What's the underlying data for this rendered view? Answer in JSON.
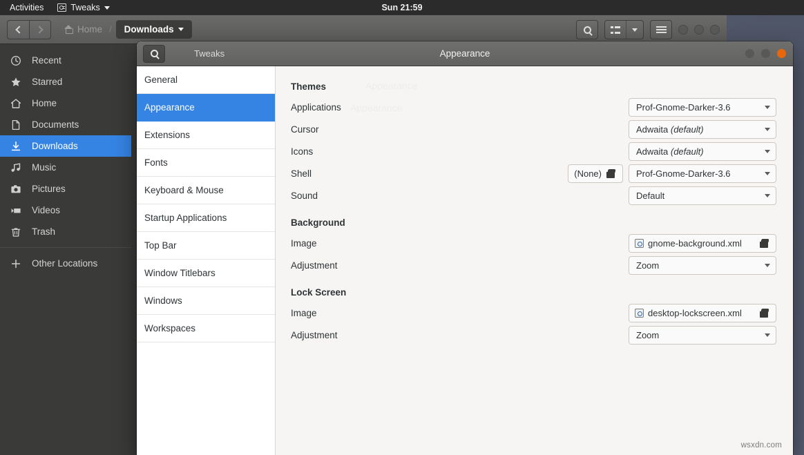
{
  "topbar": {
    "activities": "Activities",
    "app_name": "Tweaks",
    "app_icon": "tweaks-app-icon",
    "clock": "Sun 21:59"
  },
  "file_manager": {
    "nav": {
      "back_icon": "chevron-left-icon",
      "forward_icon": "chevron-right-icon"
    },
    "breadcrumb": {
      "home_icon": "home-icon",
      "home_label": "Home",
      "separator": "/",
      "current_label": "Downloads",
      "current_caret": "chevron-down-icon"
    },
    "header_buttons": {
      "search_icon": "search-icon",
      "view_list_icon": "view-list-icon",
      "view_caret_icon": "chevron-down-icon",
      "menu_icon": "hamburger-menu-icon",
      "minimize": "minimize-button",
      "maximize": "maximize-button",
      "close": "close-button"
    },
    "places": [
      {
        "label": "Recent",
        "icon": "clock-icon",
        "selected": false
      },
      {
        "label": "Starred",
        "icon": "star-icon",
        "selected": false
      },
      {
        "label": "Home",
        "icon": "home-icon",
        "selected": false
      },
      {
        "label": "Documents",
        "icon": "document-icon",
        "selected": false
      },
      {
        "label": "Downloads",
        "icon": "download-icon",
        "selected": true
      },
      {
        "label": "Music",
        "icon": "music-note-icon",
        "selected": false
      },
      {
        "label": "Pictures",
        "icon": "camera-icon",
        "selected": false
      },
      {
        "label": "Videos",
        "icon": "video-icon",
        "selected": false
      },
      {
        "label": "Trash",
        "icon": "trash-icon",
        "selected": false
      }
    ],
    "other_locations": {
      "label": "Other Locations",
      "icon": "plus-icon"
    }
  },
  "tweaks": {
    "search_icon": "search-icon",
    "app_label": "Tweaks",
    "title": "Appearance",
    "window_controls": {
      "minimize": "minimize-button",
      "maximize": "maximize-button",
      "close": "close-button",
      "close_color": "#e8670c"
    },
    "sidebar": [
      {
        "label": "General",
        "selected": false
      },
      {
        "label": "Appearance",
        "selected": true
      },
      {
        "label": "Extensions",
        "selected": false
      },
      {
        "label": "Fonts",
        "selected": false
      },
      {
        "label": "Keyboard & Mouse",
        "selected": false
      },
      {
        "label": "Startup Applications",
        "selected": false
      },
      {
        "label": "Top Bar",
        "selected": false
      },
      {
        "label": "Window Titlebars",
        "selected": false
      },
      {
        "label": "Windows",
        "selected": false
      },
      {
        "label": "Workspaces",
        "selected": false
      }
    ],
    "sections": {
      "themes": {
        "title": "Themes",
        "rows": [
          {
            "label": "Applications",
            "value": "Prof-Gnome-Darker-3.6",
            "value_suffix": "",
            "control": "combobox"
          },
          {
            "label": "Cursor",
            "value": "Adwaita ",
            "value_suffix": "(default)",
            "control": "combobox"
          },
          {
            "label": "Icons",
            "value": "Adwaita ",
            "value_suffix": "(default)",
            "control": "combobox"
          },
          {
            "label": "Shell",
            "value": "Prof-Gnome-Darker-3.6",
            "value_suffix": "",
            "control": "combobox",
            "extra_button": "(None)",
            "extra_icon": "folder-open-icon"
          },
          {
            "label": "Sound",
            "value": "Default",
            "value_suffix": "",
            "control": "combobox"
          }
        ]
      },
      "background": {
        "title": "Background",
        "image_label": "Image",
        "image_value": "gnome-background.xml",
        "image_file_icon": "xml-file-icon",
        "image_browse_icon": "folder-open-icon",
        "adjustment_label": "Adjustment",
        "adjustment_value": "Zoom"
      },
      "lock_screen": {
        "title": "Lock Screen",
        "image_label": "Image",
        "image_value": "desktop-lockscreen.xml",
        "image_file_icon": "xml-file-icon",
        "image_browse_icon": "folder-open-icon",
        "adjustment_label": "Adjustment",
        "adjustment_value": "Zoom"
      }
    }
  },
  "watermark": "wsxdn.com",
  "colors": {
    "accent_selection": "#3584e4",
    "close_button": "#e8670c",
    "topbar_bg": "#2b2b2b",
    "content_bg": "#f6f5f4"
  }
}
